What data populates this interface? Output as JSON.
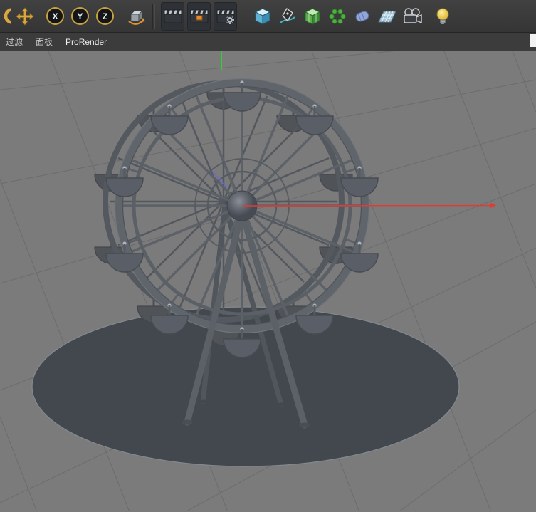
{
  "toolbar": {
    "axis_toggles": [
      "X",
      "Y",
      "Z"
    ],
    "icons": [
      "selection-tool-partial-icon",
      "move-tool-icon",
      "axis-x-toggle",
      "axis-y-toggle",
      "axis-z-toggle",
      "coordinate-system-icon",
      "render-view-icon",
      "render-picture-viewer-icon",
      "render-settings-icon",
      "add-primitive-cube-icon",
      "spline-pen-icon",
      "subdivision-surface-icon",
      "array-object-icon",
      "deformer-icon",
      "floor-grid-icon",
      "camera-icon",
      "light-icon"
    ]
  },
  "menubar": {
    "items": [
      "过滤",
      "面板",
      "ProRender"
    ]
  },
  "viewport": {
    "scene_objects": [
      "ferris-wheel",
      "ground-disc"
    ],
    "axis_gizmo": {
      "x_color": "#de3d35",
      "y_color": "#2fd32f",
      "z_color": "#6665d8"
    }
  },
  "colors": {
    "toolbar_bg": "#3a3a3a",
    "menubar_bg": "#3c3c3c",
    "viewport_bg": "#7b7b7b",
    "grid_line": "#6c6c6c",
    "model_gray": "#5c6067",
    "ground_disc": "#43484f",
    "accent_gold": "#d9a73f"
  }
}
